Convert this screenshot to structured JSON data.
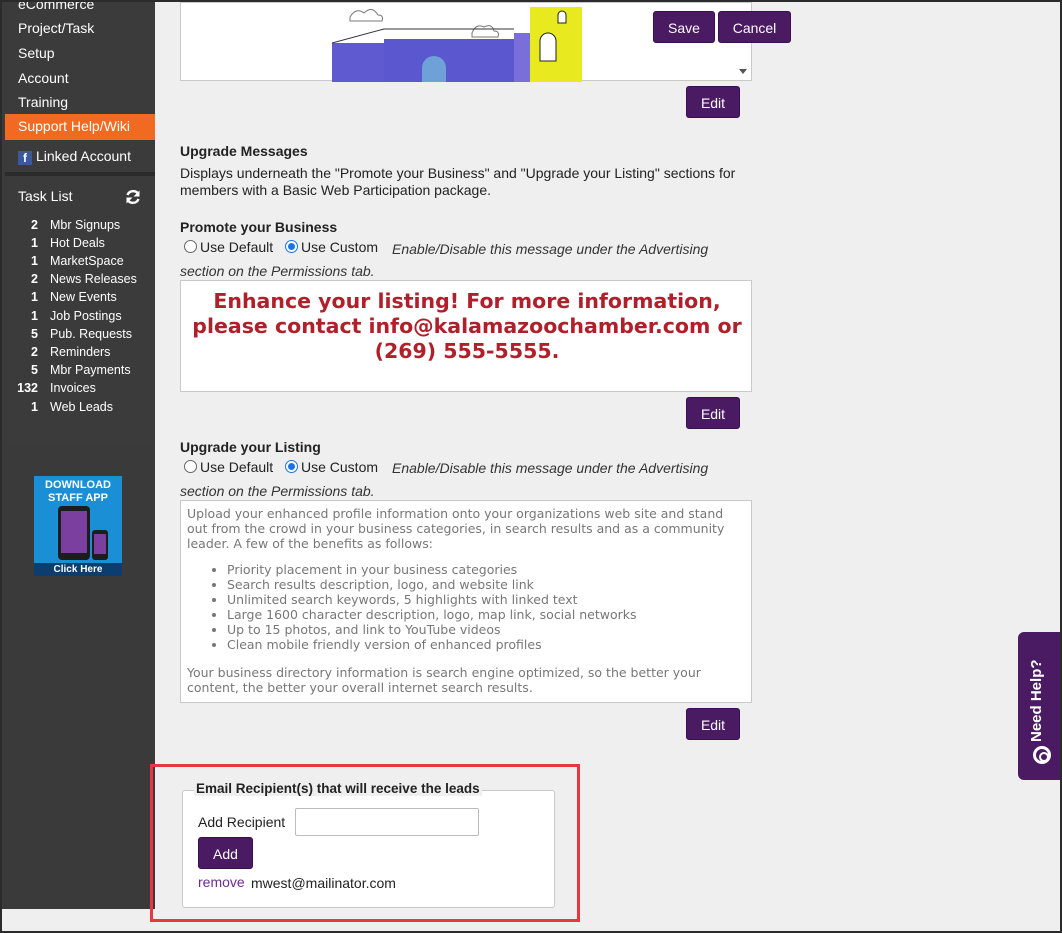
{
  "sidebar": {
    "nav": [
      {
        "label": "eCommerce"
      },
      {
        "label": "Project/Task"
      },
      {
        "label": "Setup"
      },
      {
        "label": "Account"
      },
      {
        "label": "Training"
      }
    ],
    "active_item": "Support Help/Wiki",
    "linked_account": "Linked Account",
    "task_list_title": "Task List",
    "tasks": [
      {
        "count": "2",
        "label": "Mbr Signups"
      },
      {
        "count": "1",
        "label": "Hot Deals"
      },
      {
        "count": "1",
        "label": "MarketSpace"
      },
      {
        "count": "2",
        "label": "News Releases"
      },
      {
        "count": "1",
        "label": "New Events"
      },
      {
        "count": "1",
        "label": "Job Postings"
      },
      {
        "count": "5",
        "label": "Pub. Requests"
      },
      {
        "count": "2",
        "label": "Reminders"
      },
      {
        "count": "5",
        "label": "Mbr Payments"
      },
      {
        "count": "132",
        "label": "Invoices"
      },
      {
        "count": "1",
        "label": "Web Leads"
      }
    ],
    "app_badge": {
      "line1": "DOWNLOAD",
      "line2": "STAFF APP",
      "cta": "Click Here"
    }
  },
  "top_actions": {
    "save": "Save",
    "cancel": "Cancel"
  },
  "edit_label": "Edit",
  "upgrade_messages": {
    "title": "Upgrade Messages",
    "desc_line1": "Displays underneath the \"Promote your Business\" and \"Upgrade your Listing\" sections for",
    "desc_line2": "members with a Basic Web Participation package."
  },
  "promote": {
    "title": "Promote your Business",
    "opt_default": "Use Default",
    "opt_custom": "Use Custom",
    "note_line1": "Enable/Disable this message under the Advertising",
    "note_line2": "section on the Permissions tab.",
    "message_line1": "Enhance your listing! For more information,",
    "message_line2": "please contact info@kalamazoochamber.com or",
    "message_line3": "(269) 555-5555."
  },
  "listing": {
    "title": "Upgrade your Listing",
    "opt_default": "Use Default",
    "opt_custom": "Use Custom",
    "note_line1": "Enable/Disable this message under the Advertising",
    "note_line2": "section on the Permissions tab.",
    "intro": "Upload your enhanced profile information onto your organizations web site and stand out from the crowd in your business categories, in search results and as a community leader. A few of the benefits as follows:",
    "bullets": [
      "Priority placement in your business categories",
      "Search results description, logo, and website link",
      "Unlimited search keywords, 5 highlights with linked text",
      "Large 1600 character description, logo, map link, social networks",
      "Up to 15 photos, and link to YouTube videos",
      "Clean mobile friendly version of enhanced profiles"
    ],
    "outro": "Your business directory information is search engine optimized, so the better your content, the better your overall internet search results."
  },
  "recipients": {
    "legend": "Email Recipient(s) that will receive the leads",
    "add_label": "Add Recipient",
    "input_value": "",
    "add_button": "Add",
    "remove_label": "remove",
    "email": "mwest@mailinator.com"
  },
  "need_help": "Need Help?"
}
